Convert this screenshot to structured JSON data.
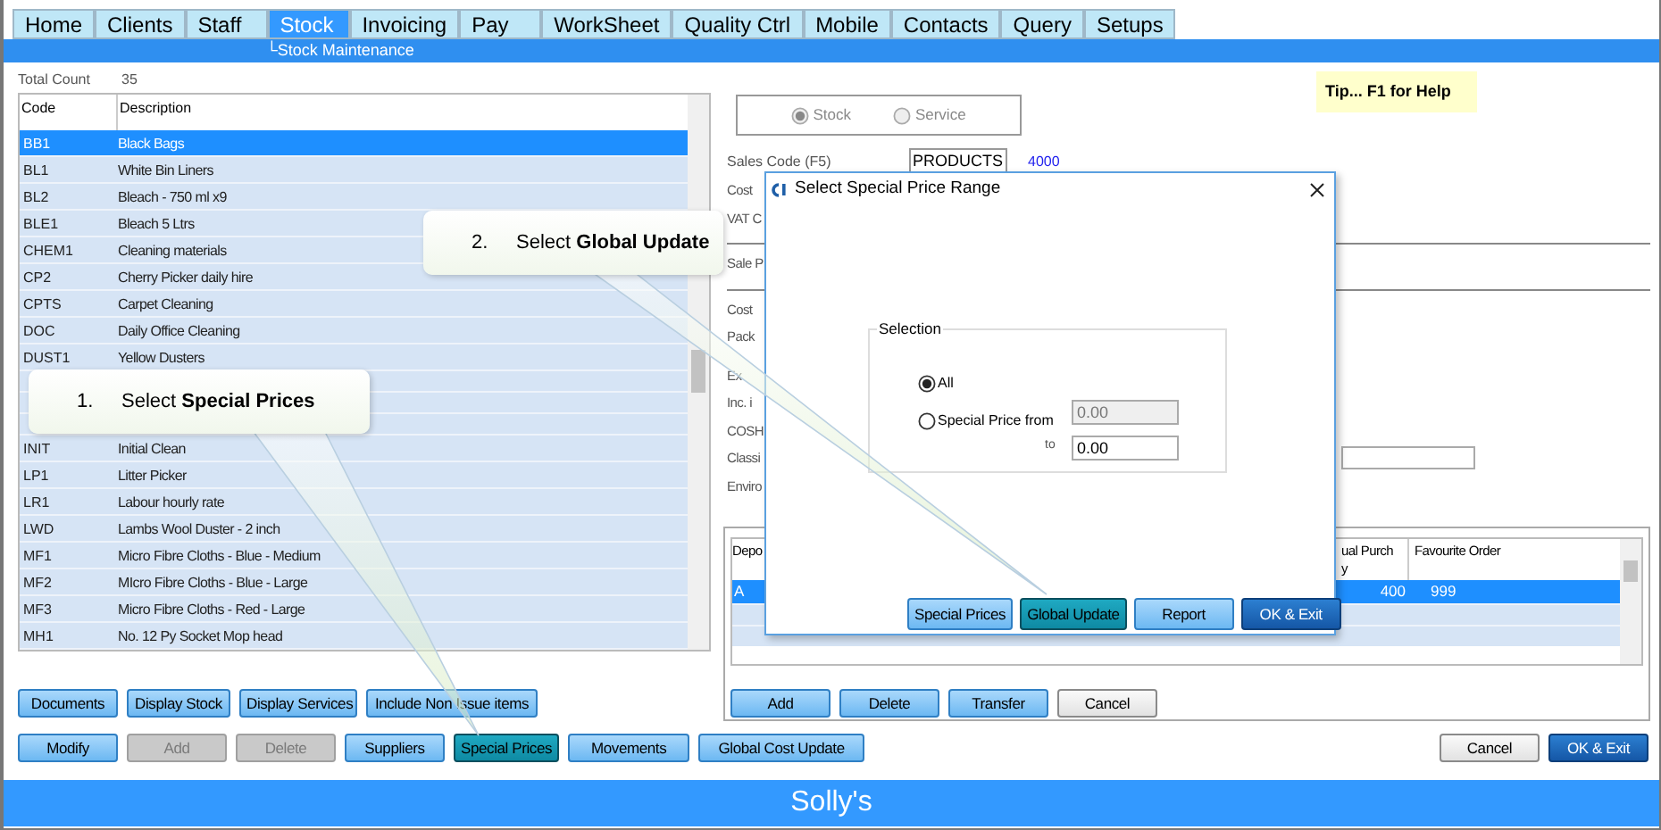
{
  "tabs": [
    {
      "label": "Home",
      "selected": false
    },
    {
      "label": "Clients",
      "selected": false
    },
    {
      "label": "Staff",
      "selected": false
    },
    {
      "label": "Stock",
      "selected": true
    },
    {
      "label": "Invoicing",
      "selected": false
    },
    {
      "label": "Pay",
      "selected": false
    },
    {
      "label": "WorkSheet",
      "selected": false
    },
    {
      "label": "Quality Ctrl",
      "selected": false
    },
    {
      "label": "Mobile",
      "selected": false
    },
    {
      "label": "Contacts",
      "selected": false
    },
    {
      "label": "Query",
      "selected": false
    },
    {
      "label": "Setups",
      "selected": false
    }
  ],
  "subtitle": "└Stock Maintenance",
  "total_count": {
    "label": "Total Count",
    "value": "35"
  },
  "stock_list": {
    "columns": [
      "Code",
      "Description"
    ],
    "rows": [
      {
        "kind": "item",
        "code": "BB1",
        "description": "Black Bags",
        "selected": true
      },
      {
        "kind": "item",
        "code": "BL1",
        "description": "White Bin Liners",
        "selected": false
      },
      {
        "kind": "item",
        "code": "BL2",
        "description": "Bleach - 750 ml x9",
        "selected": false
      },
      {
        "kind": "item",
        "code": "BLE1",
        "description": "Bleach 5 Ltrs",
        "selected": false
      },
      {
        "kind": "item",
        "code": "CHEM1",
        "description": "Cleaning materials",
        "selected": false
      },
      {
        "kind": "item",
        "code": "CP2",
        "description": "Cherry Picker daily hire",
        "selected": false
      },
      {
        "kind": "item",
        "code": "CPTS",
        "description": "Carpet Cleaning",
        "selected": false
      },
      {
        "kind": "item",
        "code": "DOC",
        "description": "Daily Office Cleaning",
        "selected": false
      },
      {
        "kind": "item",
        "code": "DUST1",
        "description": "Yellow Dusters",
        "selected": false
      },
      {
        "kind": "covered"
      },
      {
        "kind": "covered"
      },
      {
        "kind": "covered"
      },
      {
        "kind": "item",
        "code": "INIT",
        "description": "Initial Clean",
        "selected": false
      },
      {
        "kind": "item",
        "code": "LP1",
        "description": "Litter Picker",
        "selected": false
      },
      {
        "kind": "item",
        "code": "LR1",
        "description": "Labour hourly rate",
        "selected": false
      },
      {
        "kind": "item",
        "code": "LWD",
        "description": "Lambs Wool Duster - 2 inch",
        "selected": false
      },
      {
        "kind": "item",
        "code": "MF1",
        "description": "Micro Fibre Cloths - Blue - Medium",
        "selected": false
      },
      {
        "kind": "item",
        "code": "MF2",
        "description": "MIcro Fibre Cloths - Blue - Large",
        "selected": false
      },
      {
        "kind": "item",
        "code": "MF3",
        "description": "Micro Fibre Cloths - Red - Large",
        "selected": false
      },
      {
        "kind": "item",
        "code": "MH1",
        "description": "No. 12 Py Socket Mop head",
        "selected": false
      }
    ]
  },
  "list_buttons": [
    {
      "label": "Documents",
      "kind": "normal"
    },
    {
      "label": "Display Stock",
      "kind": "normal"
    },
    {
      "label": "Display Services",
      "kind": "normal"
    },
    {
      "label": "Include Non Issue items",
      "kind": "normal"
    }
  ],
  "type_options": [
    {
      "label": "Stock",
      "selected": true
    },
    {
      "label": "Service",
      "selected": false
    }
  ],
  "tip": "Tip... F1 for Help",
  "sales_code": {
    "label": "Sales Code (F5)",
    "value": "PRODUCTS",
    "code": "4000"
  },
  "form_groups": [
    [
      {
        "label": "Cost",
        "kind": "label"
      },
      {
        "label": "VAT C",
        "kind": "label"
      }
    ],
    [
      {
        "label": "Sale P",
        "kind": "label"
      }
    ],
    [
      {
        "label": "Cost",
        "kind": "label"
      },
      {
        "label": "Pack",
        "kind": "label"
      }
    ],
    [
      {
        "label": "Ex",
        "kind": "label"
      },
      {
        "label": "Inc. i",
        "kind": "label"
      },
      {
        "label": "COSH",
        "kind": "label"
      },
      {
        "label": "Classi",
        "kind": "field"
      },
      {
        "label": "Enviro",
        "kind": "label"
      }
    ]
  ],
  "depot_grid": {
    "columns": [
      "Depo",
      "ual Purch\ny",
      "Favourite Order"
    ],
    "rows": [
      {
        "cells": [
          "A",
          "400",
          "999"
        ],
        "selected": true
      }
    ]
  },
  "depot_buttons": [
    {
      "label": "Add",
      "kind": "normal"
    },
    {
      "label": "Delete",
      "kind": "normal"
    },
    {
      "label": "Transfer",
      "kind": "normal"
    },
    {
      "label": "Cancel",
      "kind": "plain"
    }
  ],
  "bottom_buttons": [
    {
      "label": "Modify",
      "kind": "normal"
    },
    {
      "label": "Add",
      "kind": "disabled"
    },
    {
      "label": "Delete",
      "kind": "disabled"
    },
    {
      "label": "Suppliers",
      "kind": "normal"
    },
    {
      "label": "Special Prices",
      "kind": "active"
    },
    {
      "label": "Movements",
      "kind": "normal"
    },
    {
      "label": "Global Cost Update",
      "kind": "normal"
    }
  ],
  "exit_buttons": [
    {
      "label": "Cancel",
      "kind": "plain"
    },
    {
      "label": "OK & Exit",
      "kind": "primary"
    }
  ],
  "dialog": {
    "title": "Select Special Price Range",
    "group_label": "Selection",
    "options": [
      {
        "label": "All",
        "selected": true
      },
      {
        "label": "Special Price from",
        "selected": false
      }
    ],
    "from_value": "0.00",
    "to_label": "to",
    "to_value": "0.00",
    "buttons": [
      {
        "label": "Special Prices",
        "kind": "normal"
      },
      {
        "label": "Global Update",
        "kind": "active"
      },
      {
        "label": "Report",
        "kind": "normal"
      },
      {
        "label": "OK & Exit",
        "kind": "primary"
      }
    ]
  },
  "callouts": [
    {
      "number": "1.",
      "text": "Select **Special Prices**"
    },
    {
      "number": "2.",
      "text": "Select **Global Update**"
    }
  ],
  "footer": "Solly's"
}
